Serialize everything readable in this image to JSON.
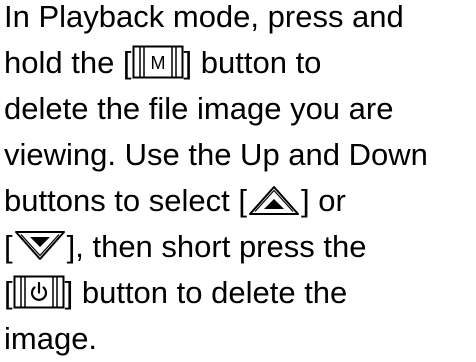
{
  "paragraph": {
    "line1": "In Playback mode, press and",
    "line2_pre": "hold the [",
    "line2_post": "] button to",
    "line3": "delete the file image you are",
    "line4": "viewing. Use the Up and Down",
    "line5_pre": "buttons to select [",
    "line5_post": "] or",
    "line6_pre": "[",
    "line6_post": "], then short press the",
    "line7_pre": "[",
    "line7_post": "] button to delete the",
    "line8": "image."
  },
  "icons": {
    "mode_button": {
      "name": "mode-button-icon",
      "label": "M"
    },
    "up_button": {
      "name": "up-arrow-button-icon"
    },
    "down_button": {
      "name": "down-arrow-button-icon"
    },
    "power_button": {
      "name": "power-button-icon"
    }
  }
}
